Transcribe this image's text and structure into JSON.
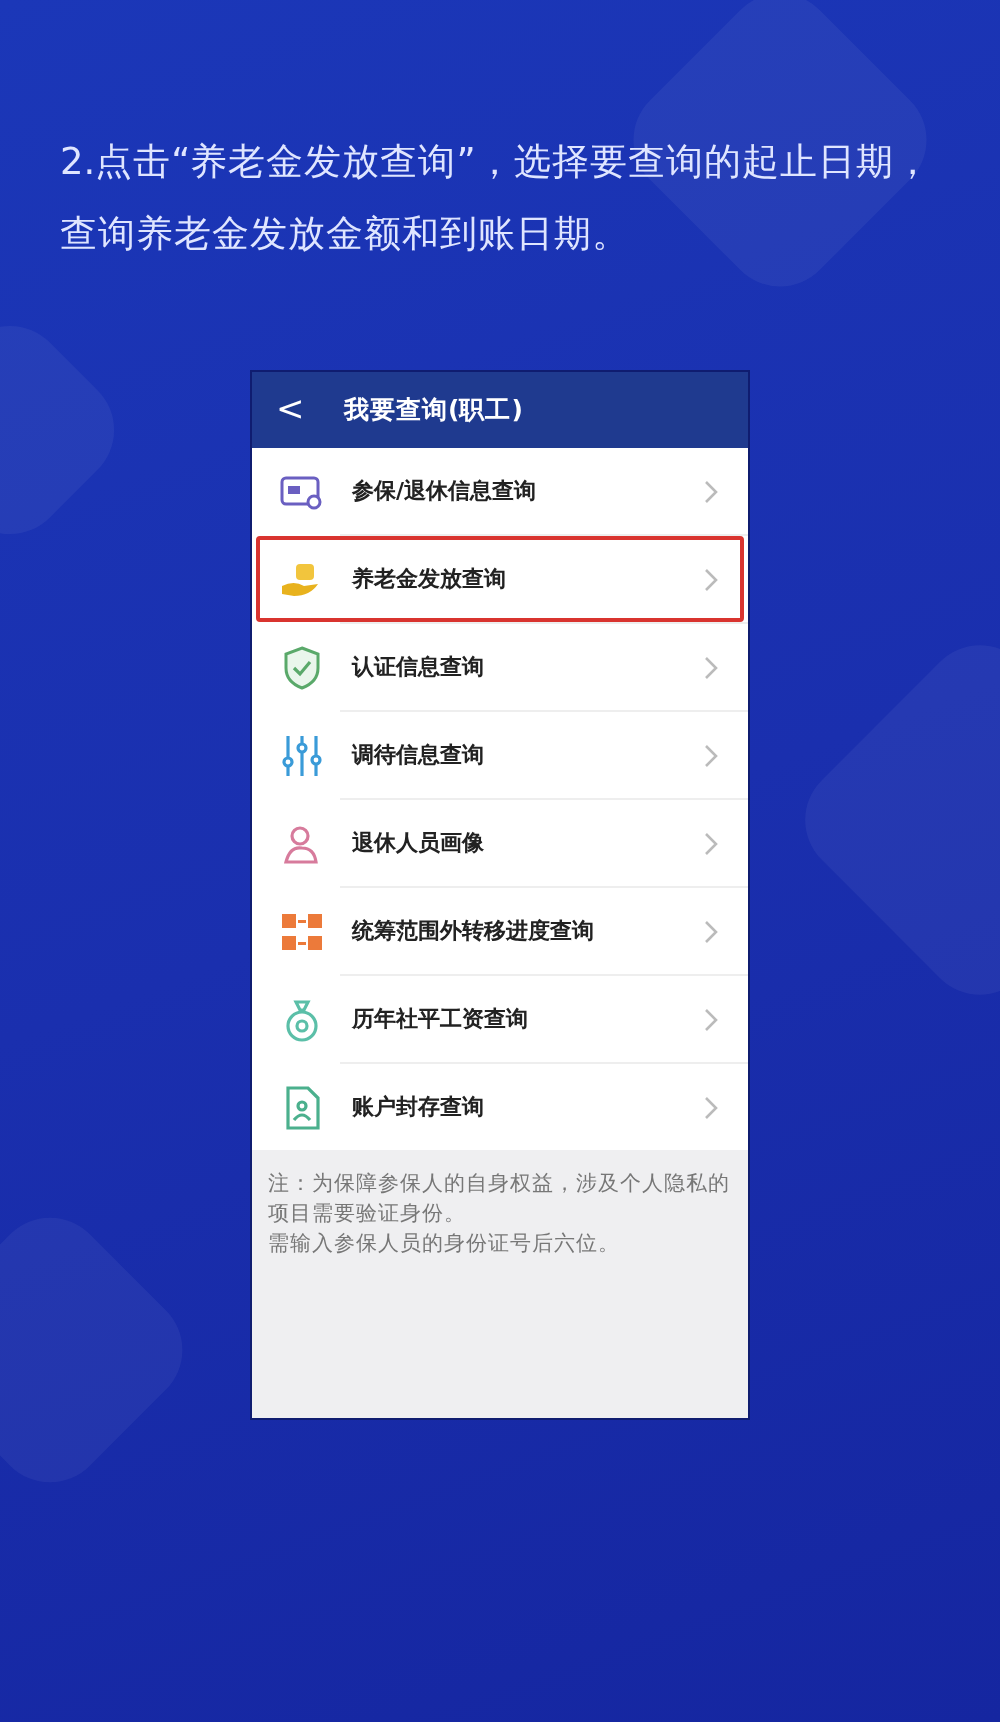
{
  "instruction": {
    "lines": [
      "2.点击“养老金发放查询”，选择要查询的起止日期，",
      "查询养老金发放金额和到账日期。"
    ]
  },
  "phone": {
    "header": {
      "back": "<",
      "title": "我要查询(职工)"
    },
    "items": [
      {
        "label": "参保/退休信息查询",
        "highlighted": false
      },
      {
        "label": "养老金发放查询",
        "highlighted": true
      },
      {
        "label": "认证信息查询",
        "highlighted": false
      },
      {
        "label": "调待信息查询",
        "highlighted": false
      },
      {
        "label": "退休人员画像",
        "highlighted": false
      },
      {
        "label": "统筹范围外转移进度查询",
        "highlighted": false
      },
      {
        "label": "历年社平工资查询",
        "highlighted": false
      },
      {
        "label": "账户封存查询",
        "highlighted": false
      }
    ],
    "note": [
      "注：为保障参保人的自身权益，涉及个人隐私的项目需要验证身份。",
      "需输入参保人员的身份证号后六位。"
    ]
  }
}
